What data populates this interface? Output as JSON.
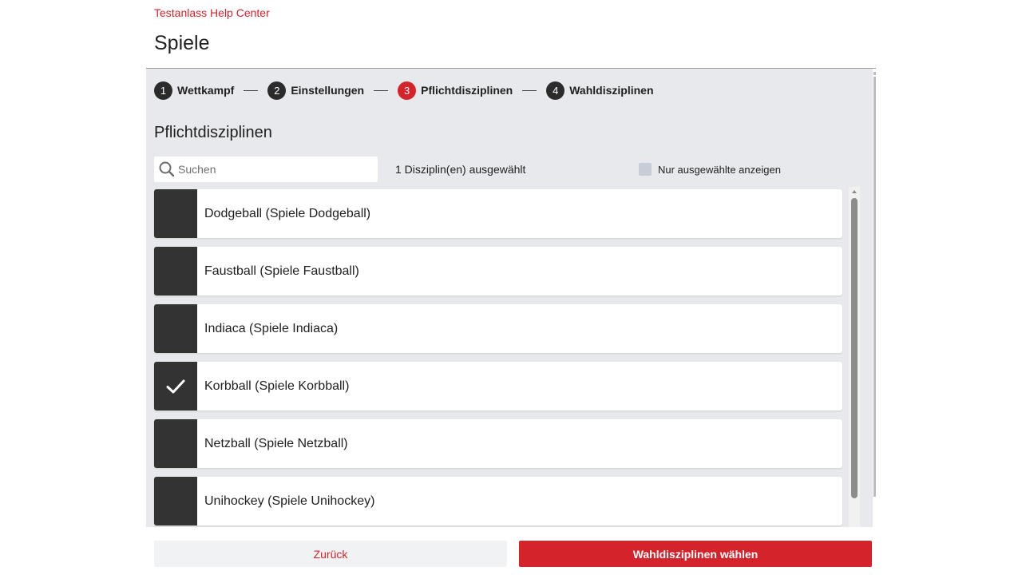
{
  "breadcrumb": "Testanlass Help Center",
  "page_title": "Spiele",
  "stepper": [
    {
      "number": "1",
      "label": "Wettkampf",
      "active": false
    },
    {
      "number": "2",
      "label": "Einstellungen",
      "active": false
    },
    {
      "number": "3",
      "label": "Pflichtdisziplinen",
      "active": true
    },
    {
      "number": "4",
      "label": "Wahldisziplinen",
      "active": false
    }
  ],
  "section_title": "Pflichtdisziplinen",
  "search": {
    "placeholder": "Suchen",
    "value": ""
  },
  "selected_count_text": "1 Disziplin(en) ausgewählt",
  "filter": {
    "label": "Nur ausgewählte anzeigen",
    "checked": false
  },
  "disciplines": [
    {
      "label": "Dodgeball (Spiele Dodgeball)",
      "selected": false
    },
    {
      "label": "Faustball (Spiele Faustball)",
      "selected": false
    },
    {
      "label": "Indiaca (Spiele Indiaca)",
      "selected": false
    },
    {
      "label": "Korbball (Spiele Korbball)",
      "selected": true
    },
    {
      "label": "Netzball (Spiele Netzball)",
      "selected": false
    },
    {
      "label": "Unihockey (Spiele Unihockey)",
      "selected": false
    }
  ],
  "footer": {
    "back_label": "Zurück",
    "next_label": "Wahldisziplinen wählen"
  },
  "colors": {
    "accent": "#d5232b",
    "dark": "#333333",
    "panel_bg": "#e8e9ec"
  },
  "icons": {
    "search": "search-icon",
    "check": "check-icon"
  }
}
